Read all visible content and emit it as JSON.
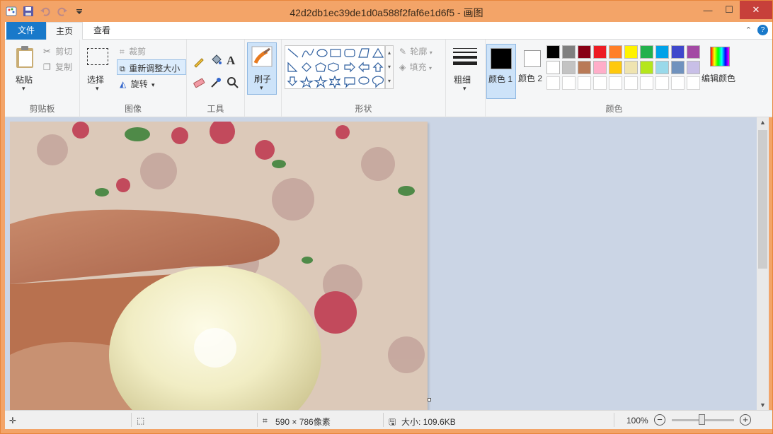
{
  "window": {
    "title": "42d2db1ec39de1d0a588f2faf6e1d6f5 - 画图",
    "controls": {
      "minimize": "—",
      "maximize": "☐",
      "close": "✕"
    }
  },
  "quick_access": {
    "icons": [
      "paint-app-icon",
      "save-icon",
      "undo-icon",
      "redo-icon",
      "customize-dropdown-icon"
    ]
  },
  "tabs": [
    {
      "label": "文件",
      "active": false
    },
    {
      "label": "主页",
      "active": true
    },
    {
      "label": "查看",
      "active": false
    }
  ],
  "ribbon": {
    "clipboard": {
      "paste": "粘贴",
      "cut": "剪切",
      "copy": "复制",
      "group": "剪贴板"
    },
    "image": {
      "select": "选择",
      "crop": "裁剪",
      "resize": "重新调整大小",
      "rotate": "旋转",
      "group": "图像"
    },
    "tools": {
      "group": "工具"
    },
    "brushes": {
      "label": "刷子"
    },
    "shapes": {
      "outline": "轮廓",
      "fill": "填充",
      "group": "形状"
    },
    "size": {
      "label": "粗细"
    },
    "colors": {
      "color1": "颜色 1",
      "color2": "颜色 2",
      "edit": "编辑颜色",
      "group": "颜色",
      "color1_value": "#000000",
      "color2_value": "#ffffff",
      "palette_row1": [
        "#000000",
        "#7f7f7f",
        "#880015",
        "#ed1c24",
        "#ff7f27",
        "#fff200",
        "#22b14c",
        "#00a2e8",
        "#3f48cc",
        "#a349a4"
      ],
      "palette_row2": [
        "#ffffff",
        "#c3c3c3",
        "#b97a57",
        "#ffaec9",
        "#ffc90e",
        "#efe4b0",
        "#b5e61d",
        "#99d9ea",
        "#7092be",
        "#c8bfe7"
      ]
    }
  },
  "status": {
    "dimensions": "590 × 786像素",
    "file_size": "大小: 109.6KB",
    "zoom": "100%"
  }
}
